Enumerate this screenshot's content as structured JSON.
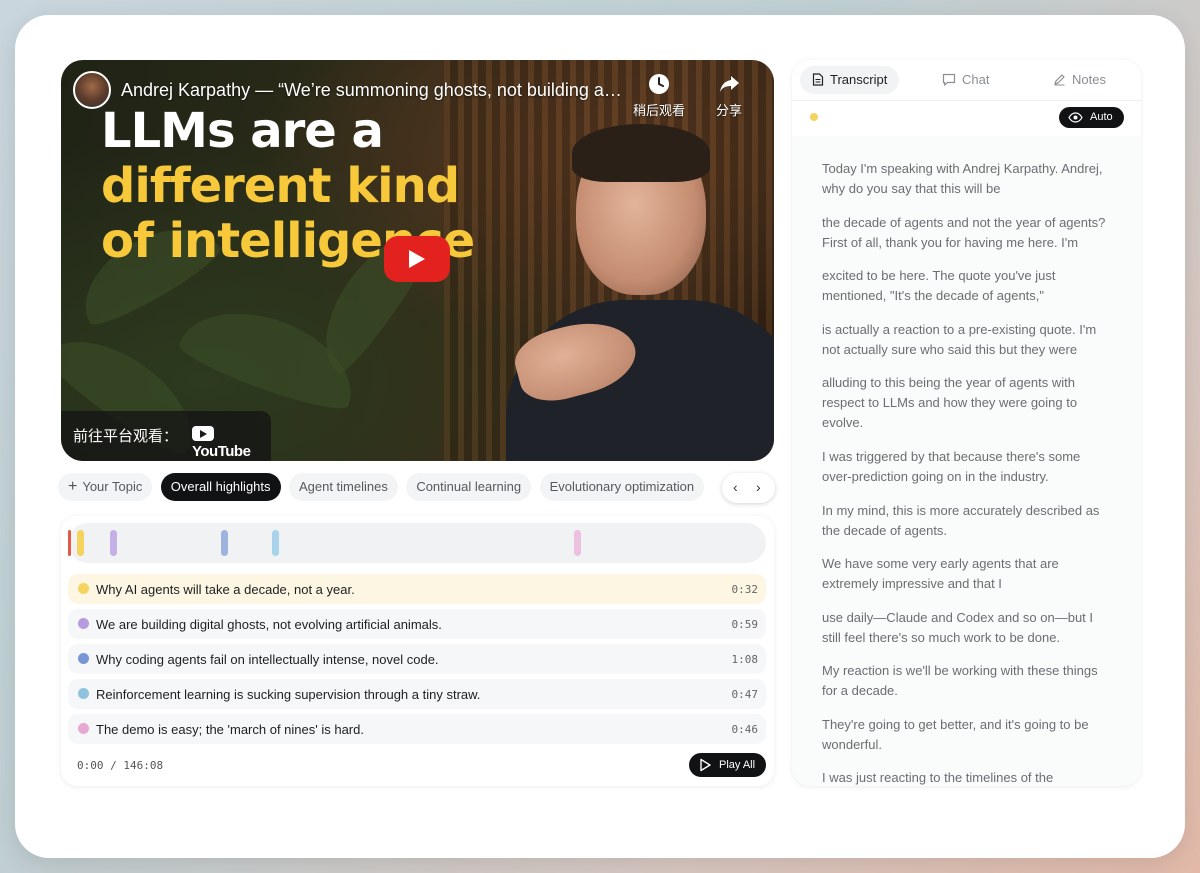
{
  "video": {
    "title": "Andrej Karpathy — “We’re summoning ghosts, not building anim…",
    "watch_later_label": "稍后观看",
    "share_label": "分享",
    "headline_line1": "LLMs are a",
    "headline_line2": "different kind",
    "headline_line3": "of intelligence",
    "watch_on_label": "前往平台观看：",
    "platform_label": "YouTube"
  },
  "topics": {
    "add_label": "Your Topic",
    "items": [
      {
        "label": "Overall highlights",
        "active": true
      },
      {
        "label": "Agent timelines",
        "active": false
      },
      {
        "label": "Continual learning",
        "active": false
      },
      {
        "label": "Evolutionary optimization",
        "active": false
      }
    ]
  },
  "highlights": {
    "items": [
      {
        "text": "Why AI agents will take a decade, not a year.",
        "time": "0:32",
        "color": "#f4d35e"
      },
      {
        "text": "We are building digital ghosts, not evolving artificial animals.",
        "time": "0:59",
        "color": "#b69be0"
      },
      {
        "text": "Why coding agents fail on intellectually intense, novel code.",
        "time": "1:08",
        "color": "#7a95d6"
      },
      {
        "text": "Reinforcement learning is sucking supervision through a tiny straw.",
        "time": "0:47",
        "color": "#8fc3e0"
      },
      {
        "text": "The demo is easy; the 'march of nines' is hard.",
        "time": "0:46",
        "color": "#e7a9d4"
      }
    ],
    "progress": "0:00 / 146:08",
    "play_all_label": "Play All"
  },
  "side": {
    "tabs": [
      {
        "label": "Transcript",
        "icon": "document-icon",
        "active": true
      },
      {
        "label": "Chat",
        "icon": "chat-bubble-icon",
        "active": false
      },
      {
        "label": "Notes",
        "icon": "pencil-icon",
        "active": false
      }
    ],
    "auto_label": "Auto",
    "transcript": [
      "Today I'm speaking with Andrej Karpathy. Andrej, why do you say that this will be",
      "the decade of agents and not the year of agents? First of all, thank you for having me here. I'm",
      "excited to be here. The quote you've just mentioned, \"It's the decade of agents,\"",
      "is actually a reaction to a pre-existing quote. I'm not actually sure who said this but they were",
      "alluding to this being the year of agents with respect to LLMs and how they were going to evolve.",
      "I was triggered by that because there's some over-prediction going on in the industry.",
      "In my mind, this is more accurately  described as the decade of agents.",
      "We have some very early agents that  are extremely impressive and that I",
      "use daily—Claude and Codex and so on—but I  still feel there's so much work to be done.",
      "My reaction is we'll be working  with these things for a decade.",
      "They're going to get better,  and it's going to be wonderful.",
      "I was just reacting to the  timelines of the"
    ]
  },
  "colors": {
    "accent_dark": "#111214",
    "headline_yellow": "#f6c83a",
    "youtube_red": "#e3221f"
  }
}
